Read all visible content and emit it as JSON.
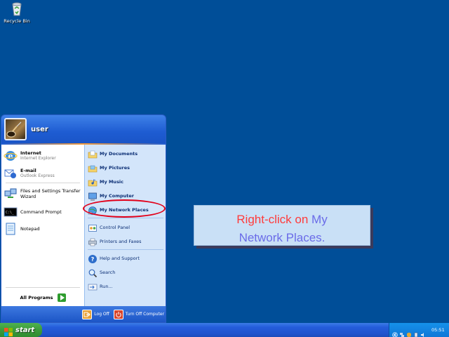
{
  "desktop": {
    "icons": [
      {
        "label": "Recycle Bin",
        "icon": "recycle-bin-icon"
      }
    ]
  },
  "start_menu": {
    "user": {
      "name": "user",
      "avatar_icon": "guitar-avatar"
    },
    "left": {
      "pinned": [
        {
          "title": "Internet",
          "subtitle": "Internet Explorer",
          "icon": "internet-explorer-icon"
        },
        {
          "title": "E-mail",
          "subtitle": "Outlook Express",
          "icon": "outlook-express-icon"
        }
      ],
      "recent": [
        {
          "title": "Files and Settings Transfer Wizard",
          "icon": "transfer-wizard-icon"
        },
        {
          "title": "Command Prompt",
          "icon": "command-prompt-icon"
        },
        {
          "title": "Notepad",
          "icon": "notepad-icon"
        }
      ],
      "all_programs": "All Programs"
    },
    "right": {
      "items": [
        {
          "label": "My Documents",
          "icon": "my-documents-icon"
        },
        {
          "label": "My Pictures",
          "icon": "my-pictures-icon"
        },
        {
          "label": "My Music",
          "icon": "my-music-icon"
        },
        {
          "label": "My Computer",
          "icon": "my-computer-icon"
        },
        {
          "label": "My Network Places",
          "icon": "my-network-places-icon"
        },
        {
          "label": "Control Panel",
          "icon": "control-panel-icon"
        },
        {
          "label": "Printers and Faxes",
          "icon": "printers-faxes-icon"
        },
        {
          "label": "Help and Support",
          "icon": "help-support-icon"
        },
        {
          "label": "Search",
          "icon": "search-icon"
        },
        {
          "label": "Run...",
          "icon": "run-icon"
        }
      ]
    },
    "footer": {
      "log_off": "Log Off",
      "turn_off": "Turn Off Computer"
    }
  },
  "instruction": {
    "part1": "Right-click on",
    "part2": "My",
    "part3": "Network Places."
  },
  "taskbar": {
    "start_label": "start",
    "clock": "05:51"
  },
  "colors": {
    "desktop": "#004e98",
    "highlight": "#e2001a",
    "instruction_red": "#ff3b3b",
    "instruction_blue": "#6a6be8"
  }
}
